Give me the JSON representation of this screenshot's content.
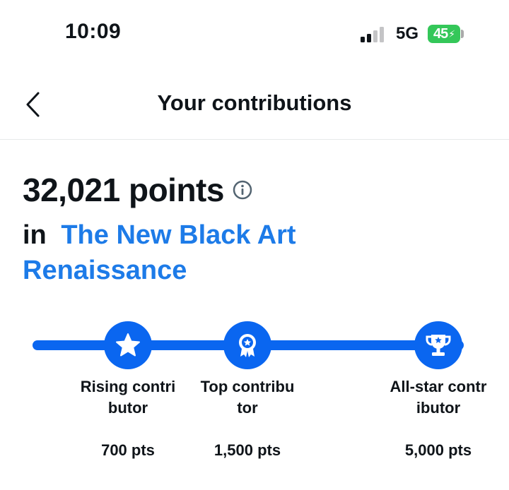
{
  "status_bar": {
    "time": "10:09",
    "network": "5G",
    "battery": "45",
    "battery_color": "#34c759"
  },
  "header": {
    "back_icon": "chevron-left-icon",
    "title": "Your contributions"
  },
  "summary": {
    "points": "32,021 points",
    "info_icon": "info-circle-icon",
    "community_prefix": "in",
    "community_name": "The New Black Art Renaissance"
  },
  "milestones": [
    {
      "icon": "star-badge-icon",
      "label": "Rising contributor",
      "points": "700 pts"
    },
    {
      "icon": "ribbon-badge-icon",
      "label": "Top contributor",
      "points": "1,500 pts"
    },
    {
      "icon": "trophy-icon",
      "label": "All-star contributor",
      "points": "5,000 pts"
    }
  ],
  "colors": {
    "accent": "#0a66f0",
    "link": "#1d7be8",
    "text": "#0f1419"
  }
}
